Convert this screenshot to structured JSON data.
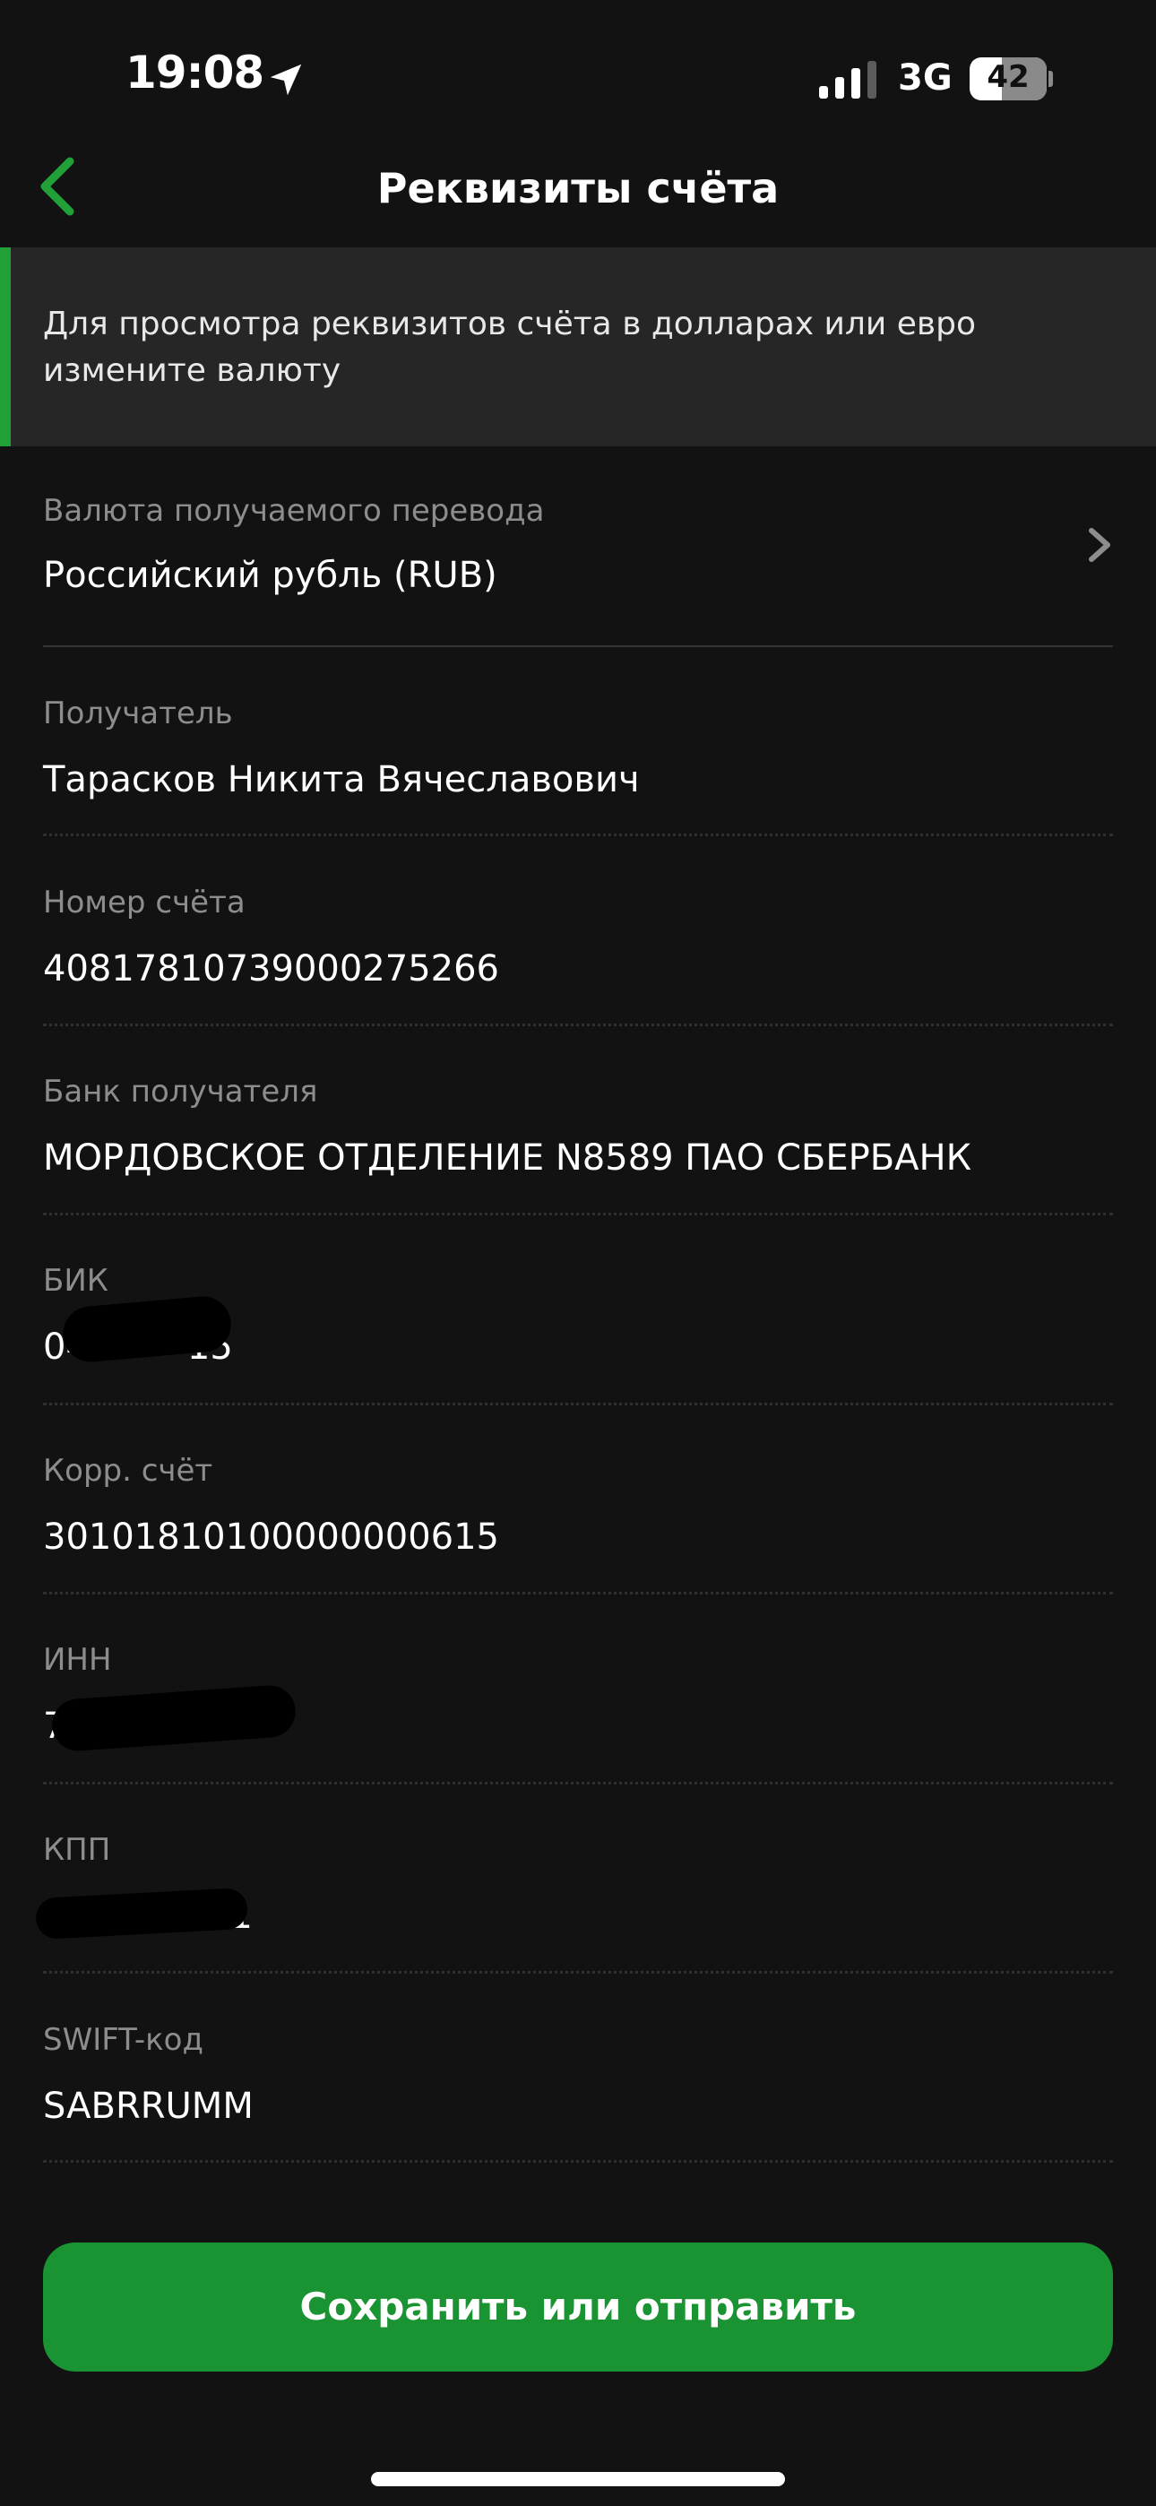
{
  "status_bar": {
    "time": "19:08",
    "network": "3G",
    "battery": "42",
    "icons": [
      "location-arrow-icon",
      "signal-bars-icon",
      "battery-icon"
    ]
  },
  "nav": {
    "title": "Реквизиты счёта",
    "back_icon": "chevron-left-icon"
  },
  "notice": {
    "text": "Для просмотра реквизитов счёта в долларах или евро измените валюту"
  },
  "currency": {
    "label": "Валюта получаемого перевода",
    "value": "Российский рубль (RUB)",
    "icon": "chevron-right-icon"
  },
  "fields": [
    {
      "label": "Получатель",
      "value": "Тарасков Никита Вячеславович"
    },
    {
      "label": "Номер счёта",
      "value": "40817810739000275266"
    },
    {
      "label": "Банк получателя",
      "value": "МОРДОВСКОЕ ОТДЕЛЕНИЕ N8589 ПАО СБЕРБАНК"
    },
    {
      "label": "БИК",
      "value": "04",
      "value_end": "15",
      "redacted": true
    },
    {
      "label": "Корр. счёт",
      "value": "30101810100000000615"
    },
    {
      "label": "ИНН",
      "value": "77",
      "redacted": true
    },
    {
      "label": "КПП",
      "value": "13",
      "value_end": "01",
      "redacted": true
    },
    {
      "label": "SWIFT-код",
      "value": "SABRRUMM"
    }
  ],
  "actions": {
    "save_or_send": "Сохранить или отправить"
  },
  "colors": {
    "background": "#121212",
    "accent_green": "#21a038",
    "button_green": "#1a9432",
    "label_gray": "#8d8d8d",
    "notice_bg": "#262626"
  }
}
